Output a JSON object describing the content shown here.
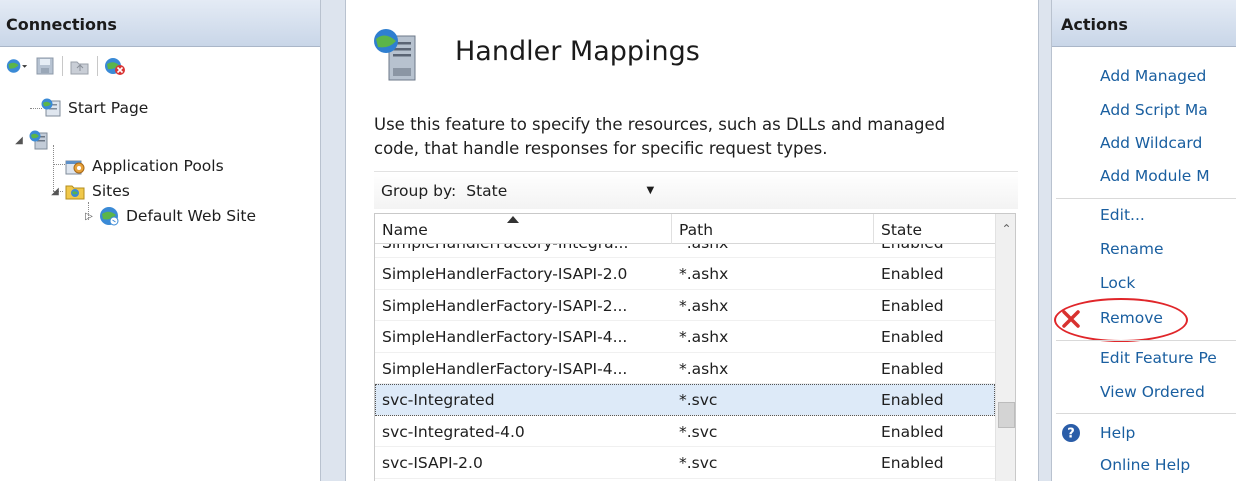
{
  "connections": {
    "title": "Connections",
    "tree": {
      "start_page": "Start Page",
      "server": "",
      "app_pools": "Application Pools",
      "sites": "Sites",
      "default_site": "Default Web Site"
    }
  },
  "feature": {
    "title": "Handler Mappings",
    "description": "Use this feature to specify the resources, such as DLLs and managed code, that handle responses for specific request types.",
    "group_by_label": "Group by:",
    "group_by_value": "State"
  },
  "table": {
    "columns": [
      "Name",
      "Path",
      "State"
    ],
    "rows": [
      {
        "name": "SimpleHandlerFactory-Integra...",
        "path": "*.ashx",
        "state": "Enabled"
      },
      {
        "name": "SimpleHandlerFactory-ISAPI-2.0",
        "path": "*.ashx",
        "state": "Enabled"
      },
      {
        "name": "SimpleHandlerFactory-ISAPI-2...",
        "path": "*.ashx",
        "state": "Enabled"
      },
      {
        "name": "SimpleHandlerFactory-ISAPI-4...",
        "path": "*.ashx",
        "state": "Enabled"
      },
      {
        "name": "SimpleHandlerFactory-ISAPI-4...",
        "path": "*.ashx",
        "state": "Enabled"
      },
      {
        "name": "svc-Integrated",
        "path": "*.svc",
        "state": "Enabled"
      },
      {
        "name": "svc-Integrated-4.0",
        "path": "*.svc",
        "state": "Enabled"
      },
      {
        "name": "svc-ISAPI-2.0",
        "path": "*.svc",
        "state": "Enabled"
      }
    ]
  },
  "actions": {
    "title": "Actions",
    "items": {
      "add_managed": "Add Managed",
      "add_script": "Add Script Ma",
      "add_wildcard": "Add Wildcard",
      "add_module": "Add Module M",
      "edit": "Edit...",
      "rename": "Rename",
      "lock": "Lock",
      "remove": "Remove",
      "edit_feature": "Edit Feature Pe",
      "view_ordered": "View Ordered",
      "help": "Help",
      "online_help": "Online Help"
    }
  },
  "colors": {
    "link": "#1a5fa0",
    "highlight": "#e0262a",
    "selected_row": "#ddeaf8"
  }
}
